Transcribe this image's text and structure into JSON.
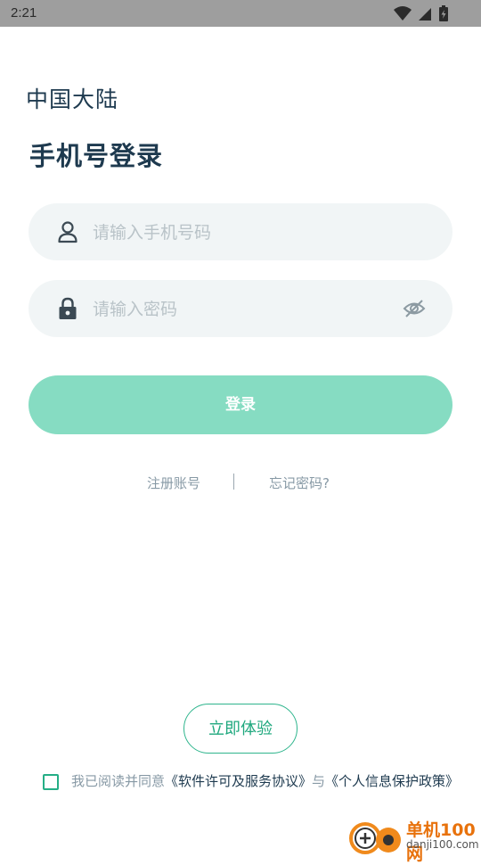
{
  "status_bar": {
    "time": "2:21"
  },
  "region": {
    "label": "中国大陆"
  },
  "title": "手机号登录",
  "phone_field": {
    "placeholder": "请输入手机号码"
  },
  "password_field": {
    "placeholder": "请输入密码"
  },
  "login_button": {
    "label": "登录"
  },
  "links": {
    "register": "注册账号",
    "forgot": "忘记密码?"
  },
  "trial_button": {
    "label": "立即体验"
  },
  "agreement": {
    "prefix": "我已阅读并同意",
    "software_agreement": "《软件许可及服务协议》",
    "and": "与",
    "privacy_policy": "《个人信息保护政策》"
  },
  "watermark": {
    "name": "单机100网",
    "url": "danji100.com"
  },
  "colors": {
    "accent": "#86dcc2",
    "accent_dark": "#1fa87e",
    "field_bg": "#f1f5f6",
    "title": "#1e3a4f",
    "status_bar": "#9e9e9e"
  },
  "icons": {
    "status": [
      "wifi-icon",
      "cell-signal-icon",
      "battery-icon"
    ],
    "phone_field": "user-icon",
    "password_field": "lock-icon",
    "password_toggle": "eye-off-icon"
  }
}
